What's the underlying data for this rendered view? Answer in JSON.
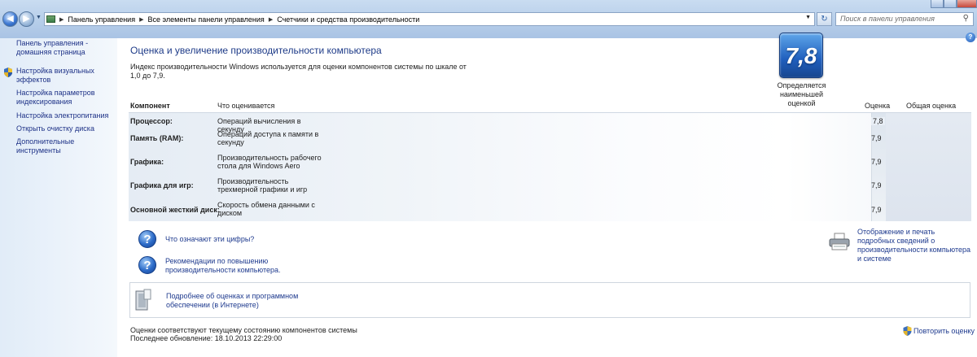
{
  "breadcrumbs": [
    "Панель управления",
    "Все элементы панели управления",
    "Счетчики и средства производительности"
  ],
  "search": {
    "placeholder": "Поиск в панели управления"
  },
  "sidebar": {
    "items": [
      {
        "label": "Панель управления - домашняя страница"
      },
      {
        "label": "Настройка визуальных эффектов",
        "icon": "shield-icon"
      },
      {
        "label": "Настройка параметров индексирования"
      },
      {
        "label": "Настройка электропитания"
      },
      {
        "label": "Открыть очистку диска"
      },
      {
        "label": "Дополнительные инструменты"
      }
    ]
  },
  "main": {
    "title": "Оценка и увеличение производительности компьютера",
    "intro": "Индекс производительности Windows используется для оценки компонентов системы по шкале от 1,0 до 7,9.",
    "table": {
      "headers": {
        "component": "Компонент",
        "what": "Что оценивается",
        "score": "Оценка",
        "overall": "Общая оценка"
      },
      "rows": [
        {
          "component": "Процессор:",
          "what": "Операций вычисления в секунду",
          "score": "7,8"
        },
        {
          "component": "Память (RAM):",
          "what": "Операций доступа к памяти в секунду",
          "score": "7,9"
        },
        {
          "component": "Графика:",
          "what": "Производительность рабочего стола для Windows Aero",
          "score": "7,9"
        },
        {
          "component": "Графика для игр:",
          "what": "Производительность трехмерной графики и игр",
          "score": "7,9"
        },
        {
          "component": "Основной жесткий диск:",
          "what": "Скорость обмена данными с диском",
          "score": "7,9"
        }
      ],
      "overall_score": "7,8",
      "overall_caption": "Определяется наименьшей оценкой"
    },
    "links": {
      "what_numbers": "Что означают эти цифры?",
      "tips": "Рекомендации по повышению производительности компьютера.",
      "print": "Отображение и печать подробных сведений о производительности компьютера и системе",
      "online": "Подробнее об оценках и программном обеспечении (в Интернете)"
    },
    "footer": {
      "state": "Оценки соответствуют текущему состоянию компонентов системы",
      "updated": "Последнее обновление: 18.10.2013 22:29:00",
      "rerun": "Повторить оценку"
    }
  }
}
